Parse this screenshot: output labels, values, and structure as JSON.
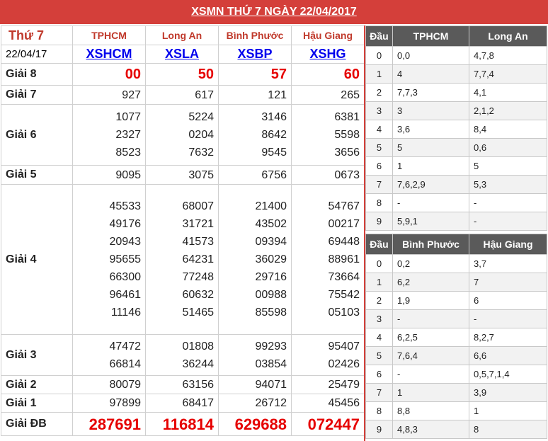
{
  "title": "XSMN THỨ 7 NGÀY 22/04/2017",
  "day_label": "Thứ 7",
  "date_label": "22/04/17",
  "provinces": [
    "TPHCM",
    "Long An",
    "Bình Phước",
    "Hậu Giang"
  ],
  "codes": [
    "XSHCM",
    "XSLA",
    "XSBP",
    "XSHG"
  ],
  "prizes": [
    {
      "label": "Giải 8",
      "values": [
        [
          "00"
        ],
        [
          "50"
        ],
        [
          "57"
        ],
        [
          "60"
        ]
      ]
    },
    {
      "label": "Giải 7",
      "values": [
        [
          "927"
        ],
        [
          "617"
        ],
        [
          "121"
        ],
        [
          "265"
        ]
      ]
    },
    {
      "label": "Giải 6",
      "values": [
        [
          "1077",
          "2327",
          "8523"
        ],
        [
          "5224",
          "0204",
          "7632"
        ],
        [
          "3146",
          "8642",
          "9545"
        ],
        [
          "6381",
          "5598",
          "3656"
        ]
      ]
    },
    {
      "label": "Giải 5",
      "values": [
        [
          "9095"
        ],
        [
          "3075"
        ],
        [
          "6756"
        ],
        [
          "0673"
        ]
      ]
    },
    {
      "label": "Giải 4",
      "values": [
        [
          "45533",
          "49176",
          "20943",
          "95655",
          "66300",
          "96461",
          "11146"
        ],
        [
          "68007",
          "31721",
          "41573",
          "64231",
          "77248",
          "60632",
          "51465"
        ],
        [
          "21400",
          "43502",
          "09394",
          "36029",
          "29716",
          "00988",
          "85598"
        ],
        [
          "54767",
          "00217",
          "69448",
          "88961",
          "73664",
          "75542",
          "05103"
        ]
      ]
    },
    {
      "label": "Giải 3",
      "values": [
        [
          "47472",
          "66814"
        ],
        [
          "01808",
          "36244"
        ],
        [
          "99293",
          "03854"
        ],
        [
          "95407",
          "02426"
        ]
      ]
    },
    {
      "label": "Giải 2",
      "values": [
        [
          "80079"
        ],
        [
          "63156"
        ],
        [
          "94071"
        ],
        [
          "25479"
        ]
      ]
    },
    {
      "label": "Giải 1",
      "values": [
        [
          "97899"
        ],
        [
          "68417"
        ],
        [
          "26712"
        ],
        [
          "45456"
        ]
      ]
    },
    {
      "label": "Giải ĐB",
      "values": [
        [
          "287691"
        ],
        [
          "116814"
        ],
        [
          "629688"
        ],
        [
          "072447"
        ]
      ]
    }
  ],
  "dau_tables": [
    {
      "headers": [
        "Đầu",
        "TPHCM",
        "Long An"
      ],
      "rows": [
        [
          "0",
          "0,0",
          "4,7,8"
        ],
        [
          "1",
          "4",
          "7,7,4"
        ],
        [
          "2",
          "7,7,3",
          "4,1"
        ],
        [
          "3",
          "3",
          "2,1,2"
        ],
        [
          "4",
          "3,6",
          "8,4"
        ],
        [
          "5",
          "5",
          "0,6"
        ],
        [
          "6",
          "1",
          "5"
        ],
        [
          "7",
          "7,6,2,9",
          "5,3"
        ],
        [
          "8",
          "-",
          "-"
        ],
        [
          "9",
          "5,9,1",
          "-"
        ]
      ]
    },
    {
      "headers": [
        "Đầu",
        "Bình Phước",
        "Hậu Giang"
      ],
      "rows": [
        [
          "0",
          "0,2",
          "3,7"
        ],
        [
          "1",
          "6,2",
          "7"
        ],
        [
          "2",
          "1,9",
          "6"
        ],
        [
          "3",
          "-",
          "-"
        ],
        [
          "4",
          "6,2,5",
          "8,2,7"
        ],
        [
          "5",
          "7,6,4",
          "6,6"
        ],
        [
          "6",
          "-",
          "0,5,7,1,4"
        ],
        [
          "7",
          "1",
          "3,9"
        ],
        [
          "8",
          "8,8",
          "1"
        ],
        [
          "9",
          "4,8,3",
          "8"
        ]
      ]
    }
  ]
}
